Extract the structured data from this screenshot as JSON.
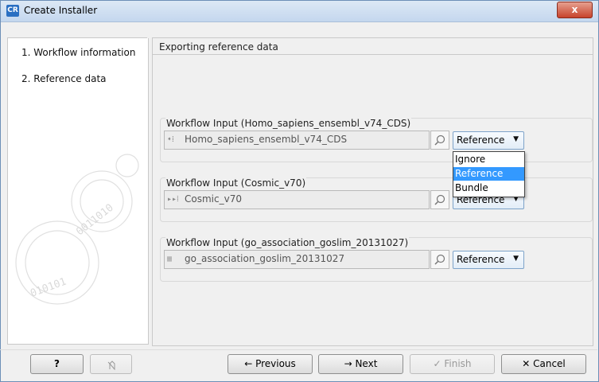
{
  "window": {
    "app_icon_text": "CR",
    "title": "Create Installer",
    "close_glyph": "x"
  },
  "steps": [
    {
      "label": "1.  Workflow information"
    },
    {
      "label": "2.  Reference data"
    }
  ],
  "section_header": "Exporting reference data",
  "inputs": [
    {
      "group_title": "Workflow Input (Homo_sapiens_ensembl_v74_CDS)",
      "value": "Homo_sapiens_ensembl_v74_CDS",
      "option": "Reference",
      "icon": "workflow-input-icon"
    },
    {
      "group_title": "Workflow Input (Cosmic_v70)",
      "value": "Cosmic_v70",
      "option": "Reference",
      "icon": "workflow-input-icon"
    },
    {
      "group_title": "Workflow Input (go_association_goslim_20131027)",
      "value": "go_association_goslim_20131027",
      "option": "Reference",
      "icon": "table-icon"
    }
  ],
  "popup_options": [
    "Ignore",
    "Reference",
    "Bundle"
  ],
  "popup_selected": "Reference",
  "buttons": {
    "help": "?",
    "previous": "← Previous",
    "next": "→ Next",
    "finish": "✓ Finish",
    "cancel": "✕ Cancel"
  }
}
